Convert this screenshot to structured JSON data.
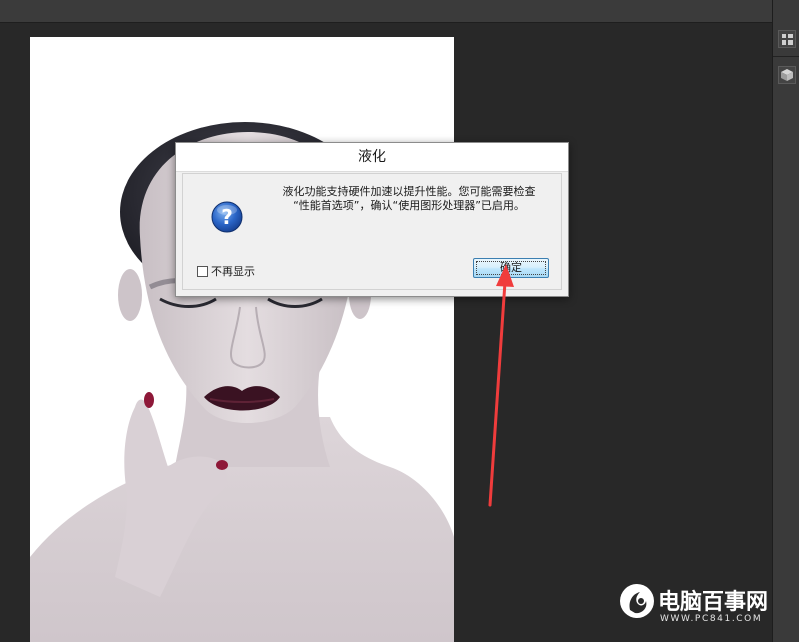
{
  "dialog": {
    "title": "液化",
    "message": "液化功能支持硬件加速以提升性能。您可能需要检查\n“性能首选项”，确认“使用图形处理器”已启用。",
    "dont_show_label": "不再显示",
    "ok_label": "确定",
    "icon": "question-icon"
  },
  "watermark": {
    "title": "电脑百事网",
    "url": "WWW.PC841.COM"
  },
  "colors": {
    "workspace": "#282828",
    "arrow": "#f03c3c",
    "button_border": "#3c7fb1"
  }
}
